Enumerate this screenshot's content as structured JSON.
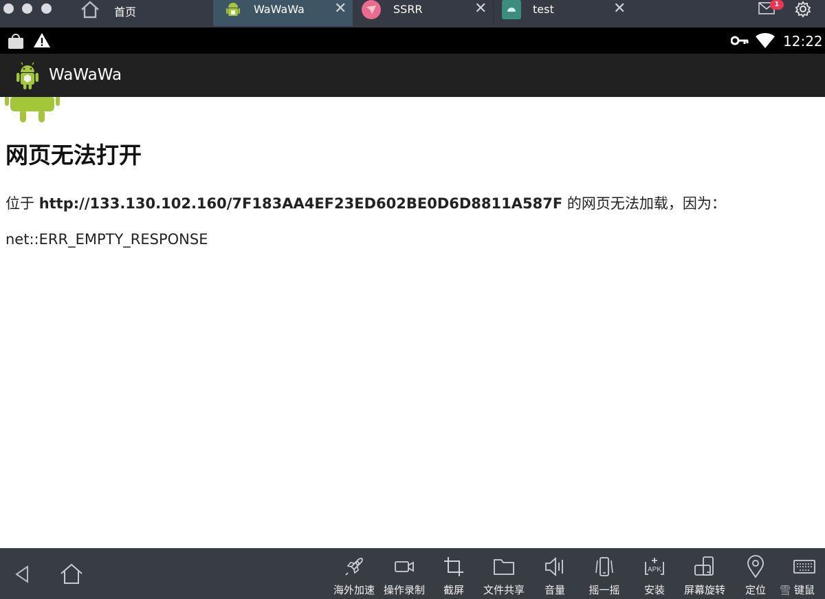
{
  "window": {
    "tabs": [
      {
        "label": "首页",
        "icon": "home-icon",
        "active": false
      },
      {
        "label": "WaWaWa",
        "icon": "android-app-icon",
        "active": true
      },
      {
        "label": "SSRR",
        "icon": "paper-plane-icon",
        "active": false
      },
      {
        "label": "test",
        "icon": "android-app-icon",
        "active": false
      }
    ],
    "mail_badge": "1",
    "colors": {
      "titlebar": "#363a44",
      "active_tab": "#3e5565",
      "badge": "#ee3552"
    }
  },
  "status_bar": {
    "time": "12:22",
    "icons": [
      "shopping-bag-icon",
      "warning-icon",
      "vpn-key-icon",
      "wifi-icon"
    ]
  },
  "action_bar": {
    "title": "WaWaWa",
    "icon": "android-app-icon"
  },
  "page": {
    "heading": "网页无法打开",
    "desc_prefix": "位于 ",
    "url": "http://133.130.102.160/7F183AA4EF23ED602BE0D6D8811A587F",
    "desc_suffix": " 的网页无法加载，因为：",
    "error_code": "net::ERR_EMPTY_RESPONSE"
  },
  "toolbar": {
    "nav": [
      "back-icon",
      "home-icon"
    ],
    "tools": [
      {
        "label": "海外加速",
        "icon": "rocket-icon"
      },
      {
        "label": "操作录制",
        "icon": "video-camera-icon"
      },
      {
        "label": "截屏",
        "icon": "crop-icon"
      },
      {
        "label": "文件共享",
        "icon": "folder-icon"
      },
      {
        "label": "音量",
        "icon": "volume-icon"
      },
      {
        "label": "摇一摇",
        "icon": "shake-icon"
      },
      {
        "label": "安装",
        "icon": "apk-install-icon"
      },
      {
        "label": "屏幕旋转",
        "icon": "rotate-screen-icon"
      },
      {
        "label": "定位",
        "icon": "location-pin-icon"
      },
      {
        "label": "键鼠",
        "icon": "keyboard-icon"
      }
    ],
    "watermark": "雪"
  }
}
